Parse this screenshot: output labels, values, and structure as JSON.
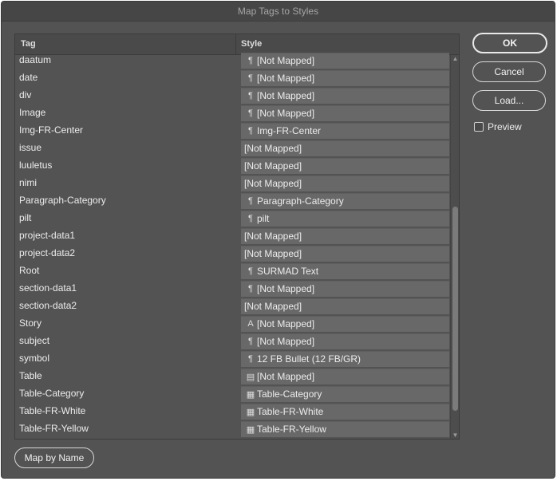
{
  "window": {
    "title": "Map Tags to Styles"
  },
  "table": {
    "headers": {
      "tag": "Tag",
      "style": "Style"
    },
    "rows": [
      {
        "tag": "daatum",
        "style": "[Not Mapped]",
        "style_icon": "paragraph-style-icon"
      },
      {
        "tag": "date",
        "style": "[Not Mapped]",
        "style_icon": "paragraph-style-icon"
      },
      {
        "tag": "div",
        "style": "[Not Mapped]",
        "style_icon": "paragraph-style-icon"
      },
      {
        "tag": "Image",
        "style": "[Not Mapped]",
        "style_icon": "paragraph-style-icon"
      },
      {
        "tag": "Img-FR-Center",
        "style": "Img-FR-Center",
        "style_icon": "paragraph-style-icon"
      },
      {
        "tag": "issue",
        "style": "[Not Mapped]",
        "style_icon": ""
      },
      {
        "tag": "luuletus",
        "style": "[Not Mapped]",
        "style_icon": ""
      },
      {
        "tag": "nimi",
        "style": "[Not Mapped]",
        "style_icon": ""
      },
      {
        "tag": "Paragraph-Category",
        "style": "Paragraph-Category",
        "style_icon": "paragraph-style-icon"
      },
      {
        "tag": "pilt",
        "style": "pilt",
        "style_icon": "paragraph-style-icon"
      },
      {
        "tag": "project-data1",
        "style": "[Not Mapped]",
        "style_icon": ""
      },
      {
        "tag": "project-data2",
        "style": "[Not Mapped]",
        "style_icon": ""
      },
      {
        "tag": "Root",
        "style": "SURMAD Text",
        "style_icon": "paragraph-style-icon"
      },
      {
        "tag": "section-data1",
        "style": "[Not Mapped]",
        "style_icon": "paragraph-style-icon"
      },
      {
        "tag": "section-data2",
        "style": "[Not Mapped]",
        "style_icon": ""
      },
      {
        "tag": "Story",
        "style": "[Not Mapped]",
        "style_icon": "character-style-icon"
      },
      {
        "tag": "subject",
        "style": "[Not Mapped]",
        "style_icon": "paragraph-style-icon"
      },
      {
        "tag": "symbol",
        "style": "12 FB Bullet (12 FB/GR)",
        "style_icon": "paragraph-style-icon"
      },
      {
        "tag": "Table",
        "style": "[Not Mapped]",
        "style_icon": "table-style-icon"
      },
      {
        "tag": "Table-Category",
        "style": "Table-Category",
        "style_icon": "cell-style-icon"
      },
      {
        "tag": "Table-FR-White",
        "style": "Table-FR-White",
        "style_icon": "cell-style-icon"
      },
      {
        "tag": "Table-FR-Yellow",
        "style": "Table-FR-Yellow",
        "style_icon": "cell-style-icon"
      }
    ]
  },
  "buttons": {
    "ok": "OK",
    "cancel": "Cancel",
    "load": "Load...",
    "map_by_name": "Map by Name"
  },
  "preview": {
    "label": "Preview",
    "checked": false
  },
  "icons": {
    "paragraph-style-icon": "¶",
    "character-style-icon": "A",
    "table-style-icon": "▤",
    "cell-style-icon": "▦"
  }
}
